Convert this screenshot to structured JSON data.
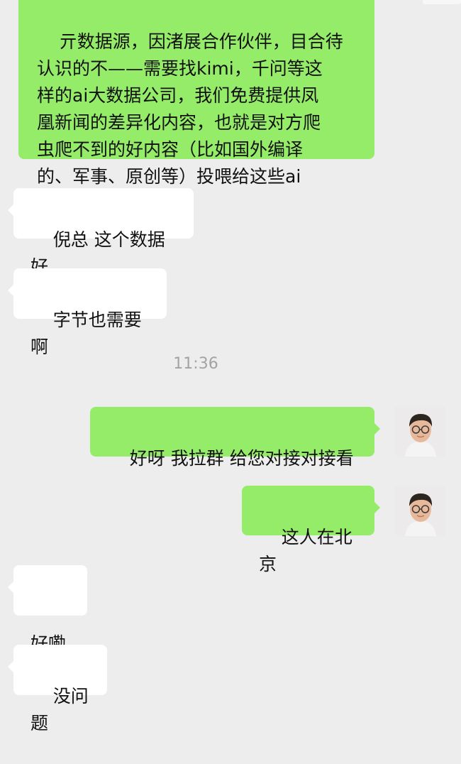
{
  "messages": {
    "m1": "亓数据源，因渚展合作伙伴，目合待\n认识的不——需要找kimi，千问等这\n样的ai大数据公司，我们免费提供凤\n凰新闻的差异化内容，也就是对方爬\n虫爬不到的好内容（比如国外编译\n的、军事、原创等）投喂给这些ai",
    "m2": "倪总 这个数据好",
    "m3": "字节也需要啊",
    "time": "11:36",
    "m4": "好呀 我拉群 给您对接对接看",
    "m5": "这人在北京",
    "m6": "好嘞",
    "m7": "没问题"
  },
  "icons": {
    "avatar": "user-avatar-icon"
  },
  "colors": {
    "background": "#ededed",
    "sent_bubble": "#95ec69",
    "received_bubble": "#ffffff",
    "timestamp": "#a3a3a3"
  }
}
